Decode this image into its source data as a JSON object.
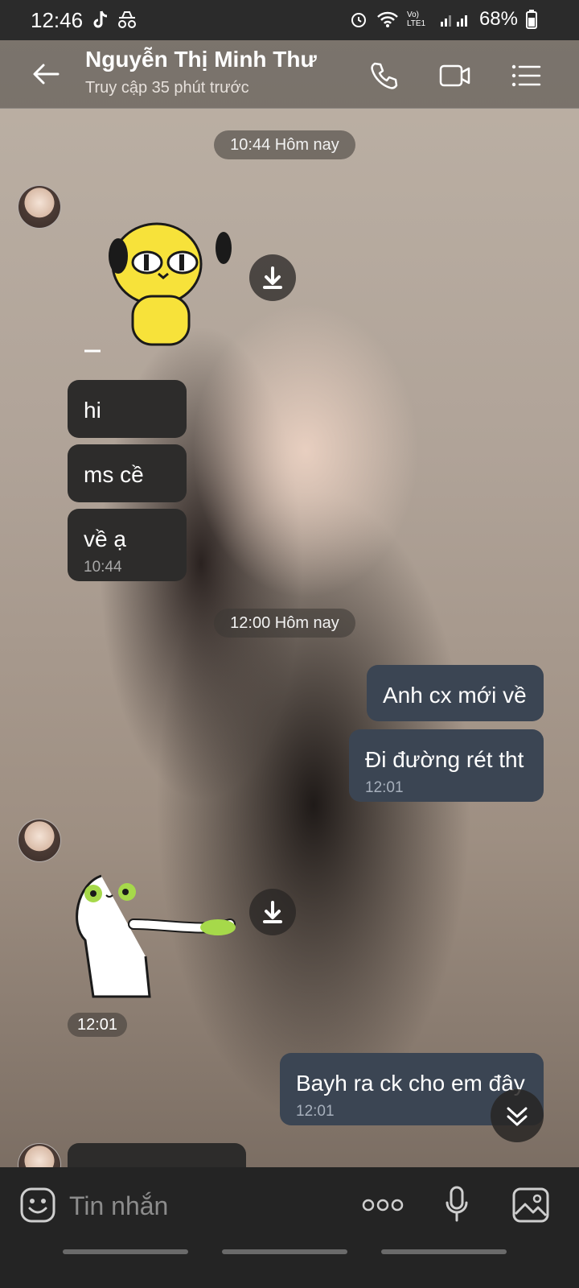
{
  "status_bar": {
    "time": "12:46",
    "network_label": "Vo) LTE1",
    "battery": "68%"
  },
  "header": {
    "name": "Nguyễn Thị Minh Thư",
    "status": "Truy cập 35 phút trước"
  },
  "chat": {
    "date_chip_1": "10:44 Hôm nay",
    "date_chip_2": "12:00 Hôm nay",
    "incoming_1": [
      "hi",
      "ms cề",
      "về ạ"
    ],
    "incoming_1_time": "10:44",
    "outgoing_1": [
      "Anh cx mới về",
      "Đi đường rét tht"
    ],
    "outgoing_1_time": "12:01",
    "sticker_time": "12:01",
    "outgoing_2": "Bayh ra ck cho em đây",
    "outgoing_2_time": "12:01"
  },
  "composer": {
    "placeholder": "Tin nhắn"
  },
  "colors": {
    "incoming_bubble": "#2d2c2b",
    "outgoing_bubble": "#3b4553",
    "composer_bg": "#242424"
  },
  "icons": [
    "tiktok-icon",
    "incognito-icon",
    "alarm-icon",
    "wifi-icon",
    "signal-icon",
    "battery-icon",
    "back-arrow-icon",
    "phone-icon",
    "video-call-icon",
    "menu-list-icon",
    "download-icon",
    "chevron-double-down-icon",
    "emoji-sticker-icon",
    "more-dots-icon",
    "microphone-icon",
    "image-gallery-icon"
  ]
}
